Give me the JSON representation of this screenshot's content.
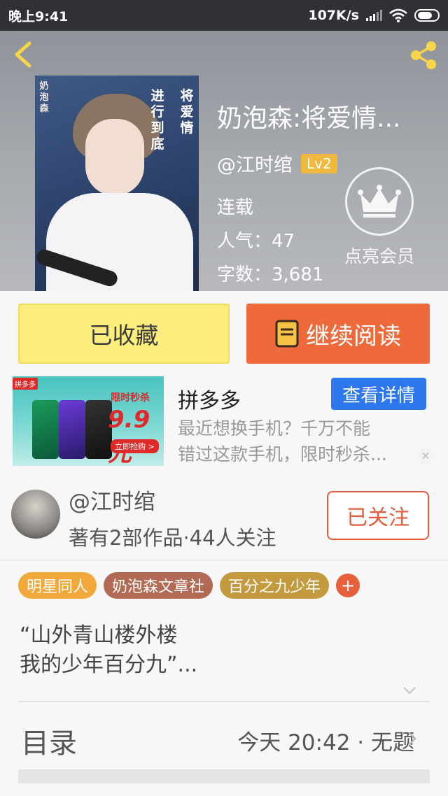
{
  "status_bar": {
    "time": "晚上9:41",
    "network_speed": "107K/s",
    "icons": [
      "signal-icon",
      "wifi-icon",
      "battery-icon"
    ]
  },
  "header": {
    "back_icon": "chevron-left-icon",
    "share_icon": "share-icon",
    "cover": {
      "title_vertical_1": [
        "将",
        "爱",
        "情"
      ],
      "title_vertical_2": [
        "进",
        "行",
        "到",
        "底"
      ],
      "small_vertical": [
        "奶",
        "泡",
        "森"
      ]
    },
    "book_title": "奶泡森:将爱情...",
    "author_handle": "@江时绾",
    "level": "Lv2",
    "status": "连载",
    "popularity": "人气：47",
    "word_count": "字数：3,681",
    "member_label": "点亮会员",
    "member_icon": "crown-icon"
  },
  "actions": {
    "collected_label": "已收藏",
    "continue_label": "继续阅读",
    "continue_icon": "book-icon"
  },
  "ad": {
    "tag": "拼多多",
    "promo_top": "限时秒杀",
    "promo_price": "9.9元",
    "promo_cta": "立即抢购 >",
    "brand": "拼多多",
    "detail_label": "查看详情",
    "description_lines": [
      "最近想换手机？千万不能",
      "错过这款手机，限时秒杀..."
    ],
    "close_icon": "close-icon"
  },
  "author": {
    "name": "@江时绾",
    "stats": "著有2部作品·44人关注",
    "follow_label": "已关注"
  },
  "tags": [
    {
      "label": "明星同人",
      "color": "#f2a93b"
    },
    {
      "label": "奶泡森文章社",
      "color": "#b26a55"
    },
    {
      "label": "百分之九少年",
      "color": "#c49a3e"
    }
  ],
  "tag_add_label": "+",
  "synopsis": {
    "line1": "“山外青山楼外楼",
    "line2": "我的少年百分九”..."
  },
  "toc": {
    "label": "目录",
    "latest": "今天 20:42 · 无题"
  },
  "colors": {
    "accent_orange": "#ef6a3b",
    "collect_yellow": "#fbee7c",
    "ad_blue": "#2d78ee",
    "level_gold": "#f0b83c"
  }
}
